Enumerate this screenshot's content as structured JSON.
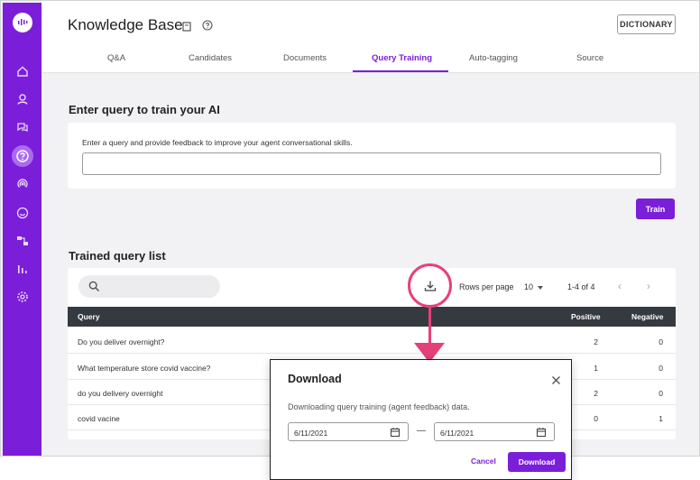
{
  "header": {
    "title": "Knowledge Base",
    "dictionary_label": "DICTIONARY",
    "tabs": [
      {
        "label": "Q&A"
      },
      {
        "label": "Candidates"
      },
      {
        "label": "Documents"
      },
      {
        "label": "Query Training"
      },
      {
        "label": "Auto-tagging"
      },
      {
        "label": "Source"
      }
    ],
    "active_tab": "Query Training"
  },
  "sidebar": {
    "icons": [
      "logo-chat-icon",
      "home-icon",
      "user-icon",
      "chat-bubbles-icon",
      "knowledge-base-icon",
      "signal-icon",
      "smile-icon",
      "flow-icon",
      "analytics-icon",
      "settings-icon"
    ],
    "active": "knowledge-base-icon"
  },
  "train_section": {
    "title": "Enter query to train your AI",
    "hint": "Enter a query and provide feedback to improve your agent conversational skills.",
    "input_value": "",
    "train_label": "Train"
  },
  "list_section": {
    "title": "Trained query list",
    "search_value": "",
    "rows_per_page_label": "Rows per page",
    "rows_per_page_value": "10",
    "range": "1-4 of 4",
    "prev_icon": "‹",
    "next_icon": "›",
    "columns": {
      "query": "Query",
      "positive": "Positive",
      "negative": "Negative"
    },
    "rows": [
      {
        "query": "Do you deliver overnight?",
        "positive": "2",
        "negative": "0"
      },
      {
        "query": "What temperature store covid vaccine?",
        "positive": "1",
        "negative": "0"
      },
      {
        "query": "do you delivery overnight",
        "positive": "2",
        "negative": "0"
      },
      {
        "query": "covid vacine",
        "positive": "0",
        "negative": "1"
      }
    ]
  },
  "dialog": {
    "title": "Download",
    "text": "Downloading query training (agent feedback) data.",
    "start_date": "6/11/2021",
    "end_date": "6/11/2021",
    "separator": "—",
    "cancel_label": "Cancel",
    "download_label": "Download"
  },
  "colors": {
    "brand": "#7b1ed9",
    "callout": "#e6407a",
    "table_header": "#343a40"
  }
}
